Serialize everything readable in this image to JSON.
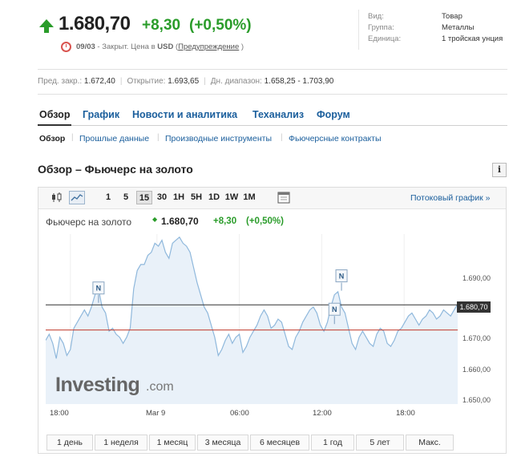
{
  "quote": {
    "last_price": "1.680,70",
    "change_abs": "+8,30",
    "change_pct": "(+0,50%)",
    "status_date": "09/03",
    "status_text": "- Закрыт. Цена в",
    "currency": "USD",
    "paren_open": "(",
    "disclaimer_link": "Предупреждение",
    "paren_close": ")"
  },
  "instrument_info": [
    {
      "label": "Вид:",
      "value": "Товар"
    },
    {
      "label": "Группа:",
      "value": "Металлы"
    },
    {
      "label": "Единица:",
      "value": "1 тройская унция"
    }
  ],
  "stats": {
    "prev_close_label": "Пред. закр.:",
    "prev_close": "1.672,40",
    "open_label": "Открытие:",
    "open": "1.693,65",
    "day_range_label": "Дн. диапазон:",
    "day_range": "1.658,25 - 1.703,90"
  },
  "nav_tabs": [
    "Обзор",
    "График",
    "Новости и аналитика",
    "Теханализ",
    "Форум"
  ],
  "subnav": [
    "Обзор",
    "Прошлые данные",
    "Производные инструменты",
    "Фьючерсные контракты"
  ],
  "section_title": "Обзор – Фьючерс на золото",
  "info_button": "i",
  "chart_toolbar": {
    "intervals": [
      "1",
      "5",
      "15",
      "30",
      "1H",
      "5H",
      "1D",
      "1W",
      "1M"
    ],
    "active_interval": "15",
    "icons": [
      "candlestick-icon",
      "line-chart-icon",
      "calendar-icon"
    ],
    "streaming_link": "Потоковый график »"
  },
  "chart_header": {
    "instrument": "Фьючерс на золото",
    "price": "1.680,70",
    "change": "+8,30",
    "change_pct": "(+0,50%)"
  },
  "news_marker": "N",
  "logo": {
    "main": "Investing",
    "suffix": ".com"
  },
  "period_buttons": [
    "1 день",
    "1 неделя",
    "1 месяц",
    "3 месяца",
    "6 месяцев",
    "1 год",
    "5 лет",
    "Макс."
  ],
  "colors": {
    "up": "#2a9c2a",
    "link": "#1a5e9c",
    "line": "#8fb8dc",
    "area": "#e9f1f9",
    "prev_close_line": "#c0392b",
    "current_line": "#333333"
  },
  "chart_data": {
    "type": "area",
    "x_ticks": [
      "18:00",
      "Mar 9",
      "06:00",
      "12:00",
      "18:00"
    ],
    "y_ticks": [
      "1.690,00",
      "1.680,00",
      "1.670,00",
      "1.660,00",
      "1.650,00"
    ],
    "ylim": [
      1648,
      1704
    ],
    "current_price": 1680.7,
    "current_price_label": "1.680,70",
    "prev_close": 1672.4,
    "grid": "vertical",
    "series": [
      {
        "values": [
          1669,
          1671,
          1668,
          1663,
          1670,
          1668,
          1664,
          1666,
          1673,
          1675,
          1677,
          1679,
          1677,
          1680,
          1684,
          1686,
          1680,
          1678,
          1672,
          1673,
          1671,
          1670,
          1668,
          1670,
          1673,
          1686,
          1692,
          1694,
          1694,
          1697,
          1698,
          1701,
          1700,
          1702,
          1698,
          1696,
          1701,
          1702,
          1703,
          1701,
          1700,
          1698,
          1693,
          1688,
          1684,
          1680,
          1678,
          1674,
          1670,
          1664,
          1666,
          1669,
          1671,
          1668,
          1670,
          1671,
          1665,
          1667,
          1670,
          1672,
          1674,
          1677,
          1679,
          1677,
          1673,
          1674,
          1676,
          1675,
          1671,
          1667,
          1666,
          1670,
          1672,
          1675,
          1677,
          1679,
          1680,
          1678,
          1674,
          1672,
          1675,
          1680,
          1684,
          1685,
          1680,
          1678,
          1673,
          1668,
          1666,
          1670,
          1672,
          1670,
          1668,
          1667,
          1671,
          1673,
          1672,
          1668,
          1667,
          1669,
          1672,
          1673,
          1675,
          1677,
          1678,
          1676,
          1674,
          1676,
          1677,
          1679,
          1678,
          1676,
          1677,
          1679,
          1678,
          1677,
          1679,
          1681
        ]
      }
    ],
    "news_markers": [
      {
        "index": 15,
        "price": 1684
      },
      {
        "index": 82,
        "price": 1677
      },
      {
        "index": 84,
        "price": 1688
      }
    ]
  }
}
